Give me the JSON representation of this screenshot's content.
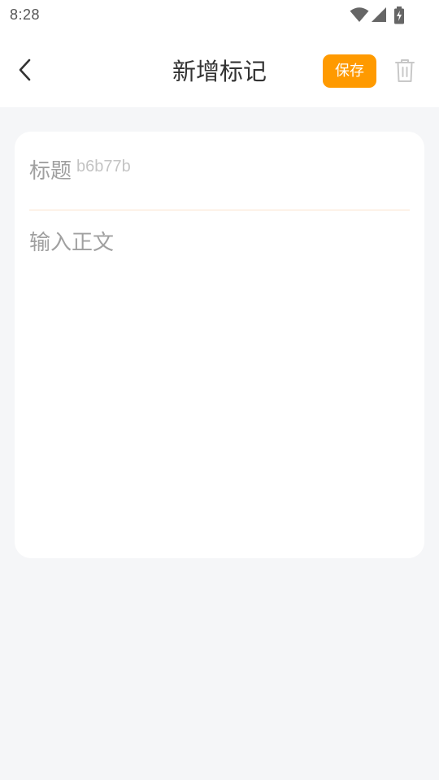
{
  "status_bar": {
    "time": "8:28",
    "icons": [
      "wifi-icon",
      "cellular-signal-icon",
      "battery-charging-icon"
    ]
  },
  "app_bar": {
    "title": "新增标记",
    "save_label": "保存",
    "icons": {
      "back": "chevron-left-icon",
      "delete": "trash-icon"
    },
    "accent_color": "#ff9a00"
  },
  "note": {
    "title_placeholder": "标题",
    "title_value": "",
    "title_hint": "b6b77b",
    "body_placeholder": "输入正文",
    "body_value": ""
  }
}
